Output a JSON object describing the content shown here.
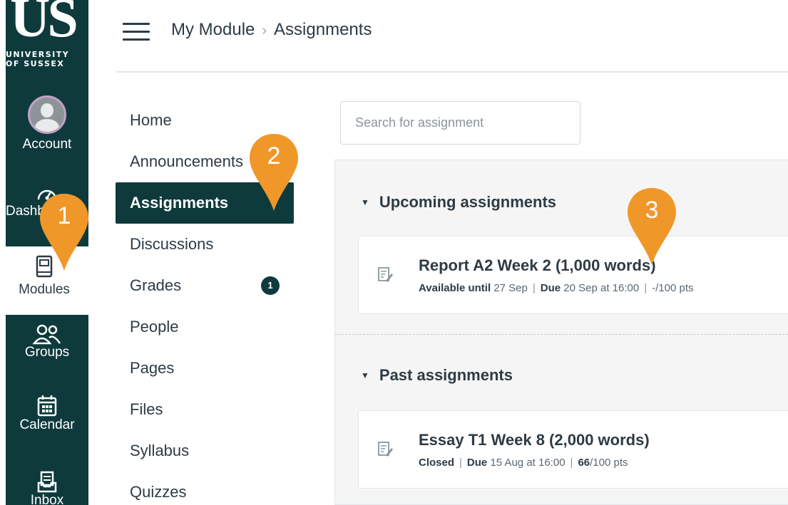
{
  "logo": {
    "mark": "US",
    "line1": "UNIVERSITY",
    "line2": "OF SUSSEX"
  },
  "global_nav": [
    {
      "label": "Account",
      "icon": "avatar"
    },
    {
      "label": "Dashboard",
      "icon": "dashboard-icon"
    },
    {
      "label": "Modules",
      "icon": "modules-icon"
    },
    {
      "label": "Groups",
      "icon": "groups-icon"
    },
    {
      "label": "Calendar",
      "icon": "calendar-icon"
    },
    {
      "label": "Inbox",
      "icon": "inbox-icon"
    }
  ],
  "header": {
    "crumb1": "My Module",
    "separator": "›",
    "crumb2": "Assignments"
  },
  "course_nav": [
    {
      "label": "Home"
    },
    {
      "label": "Announcements"
    },
    {
      "label": "Assignments",
      "active": true
    },
    {
      "label": "Discussions"
    },
    {
      "label": "Grades",
      "badge": "1"
    },
    {
      "label": "People"
    },
    {
      "label": "Pages"
    },
    {
      "label": "Files"
    },
    {
      "label": "Syllabus"
    },
    {
      "label": "Quizzes"
    }
  ],
  "search": {
    "placeholder": "Search for assignment",
    "value": ""
  },
  "groups": {
    "upcoming": {
      "title": "Upcoming assignments",
      "items": [
        {
          "title": "Report A2 Week 2 (1,000 words)",
          "status_label": "Available until",
          "status_value": "27 Sep",
          "due_label": "Due",
          "due_value": "20 Sep at 16:00",
          "points": "-/100 pts"
        }
      ]
    },
    "past": {
      "title": "Past assignments",
      "items": [
        {
          "title": "Essay T1 Week 8 (2,000 words)",
          "status_label": "Closed",
          "due_label": "Due",
          "due_value": "15 Aug at 16:00",
          "score": "66",
          "points_total": "/100 pts"
        }
      ]
    }
  },
  "callouts": [
    "1",
    "2",
    "3"
  ],
  "colors": {
    "brand": "#0e3a3c",
    "callout": "#f0972a",
    "avatar_ring": "#c4a0c8"
  }
}
